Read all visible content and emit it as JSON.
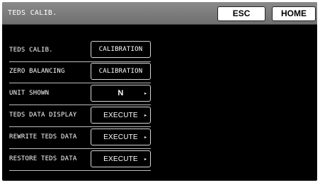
{
  "header": {
    "title": "TEDS CALIB.",
    "esc_label": "ESC",
    "home_label": "HOME"
  },
  "rows": [
    {
      "label": "TEDS CALIB.",
      "button": "CALIBRATION",
      "arrow": ""
    },
    {
      "label": "ZERO BALANCING",
      "button": "CALIBRATION",
      "arrow": ""
    },
    {
      "label": "UNIT SHOWN",
      "button": "N",
      "arrow": "▸"
    },
    {
      "label": "TEDS DATA DISPLAY",
      "button": "EXECUTE",
      "arrow": "▸"
    },
    {
      "label": "REWRITE TEDS DATA",
      "button": "EXECUTE",
      "arrow": "▸"
    },
    {
      "label": "RESTORE TEDS DATA",
      "button": "EXECUTE",
      "arrow": "▸"
    }
  ],
  "colors": {
    "background": "#000000",
    "titlebar": "#7d7d7d",
    "text": "#ffffff"
  }
}
